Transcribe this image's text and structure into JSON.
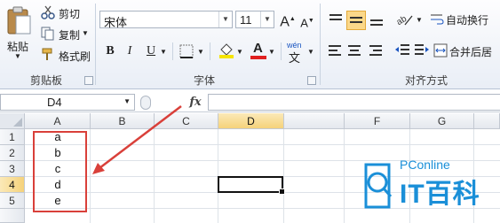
{
  "ribbon": {
    "clipboard": {
      "paste": "粘贴",
      "cut": "剪切",
      "copy": "复制",
      "format_painter": "格式刷",
      "group": "剪贴板"
    },
    "font": {
      "name": "宋体",
      "size": "11",
      "bold": "B",
      "italic": "I",
      "underline": "U",
      "font_color_glyph": "A",
      "wen": "wén",
      "wen_char": "文",
      "grow": "A",
      "shrink": "A",
      "group": "字体"
    },
    "alignment": {
      "wrap": "自动换行",
      "merge": "合并后居",
      "group": "对齐方式"
    }
  },
  "formula_bar": {
    "name_box": "D4",
    "fx": "fx",
    "value": ""
  },
  "sheet": {
    "columns": [
      "A",
      "B",
      "C",
      "D",
      "F",
      "G"
    ],
    "rows": [
      "1",
      "2",
      "3",
      "4",
      "5"
    ],
    "selected_column": "D",
    "selected_row": "4",
    "cells_A": [
      "a",
      "b",
      "c",
      "d",
      "e"
    ]
  },
  "annotation": {
    "color": "#d9403a"
  },
  "watermark": {
    "brand": "PConline",
    "logo_text": "IT百科",
    "color": "#1a8fd8"
  }
}
